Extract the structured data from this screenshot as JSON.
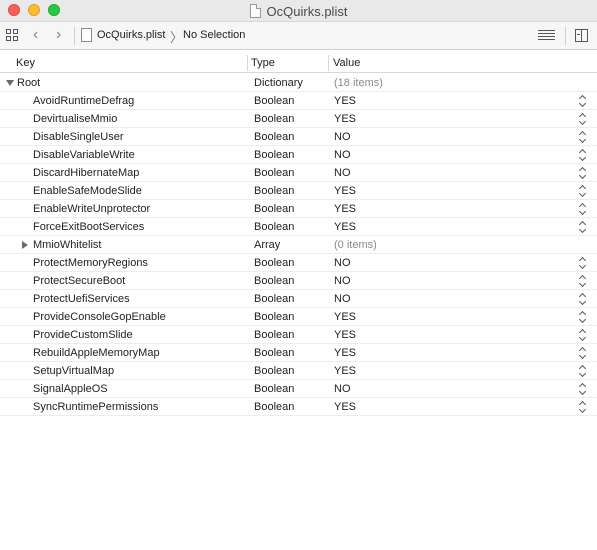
{
  "window": {
    "title": "OcQuirks.plist"
  },
  "jumpbar": {
    "file": "OcQuirks.plist",
    "selection": "No Selection"
  },
  "columns": {
    "key": "Key",
    "type": "Type",
    "value": "Value"
  },
  "root": {
    "key": "Root",
    "type": "Dictionary",
    "value": "(18 items)"
  },
  "rows": [
    {
      "key": "AvoidRuntimeDefrag",
      "type": "Boolean",
      "value": "YES"
    },
    {
      "key": "DevirtualiseMmio",
      "type": "Boolean",
      "value": "YES"
    },
    {
      "key": "DisableSingleUser",
      "type": "Boolean",
      "value": "NO"
    },
    {
      "key": "DisableVariableWrite",
      "type": "Boolean",
      "value": "NO"
    },
    {
      "key": "DiscardHibernateMap",
      "type": "Boolean",
      "value": "NO"
    },
    {
      "key": "EnableSafeModeSlide",
      "type": "Boolean",
      "value": "YES"
    },
    {
      "key": "EnableWriteUnprotector",
      "type": "Boolean",
      "value": "YES"
    },
    {
      "key": "ForceExitBootServices",
      "type": "Boolean",
      "value": "YES"
    },
    {
      "key": "MmioWhitelist",
      "type": "Array",
      "value": "(0 items)"
    },
    {
      "key": "ProtectMemoryRegions",
      "type": "Boolean",
      "value": "NO"
    },
    {
      "key": "ProtectSecureBoot",
      "type": "Boolean",
      "value": "NO"
    },
    {
      "key": "ProtectUefiServices",
      "type": "Boolean",
      "value": "NO"
    },
    {
      "key": "ProvideConsoleGopEnable",
      "type": "Boolean",
      "value": "YES"
    },
    {
      "key": "ProvideCustomSlide",
      "type": "Boolean",
      "value": "YES"
    },
    {
      "key": "RebuildAppleMemoryMap",
      "type": "Boolean",
      "value": "YES"
    },
    {
      "key": "SetupVirtualMap",
      "type": "Boolean",
      "value": "YES"
    },
    {
      "key": "SignalAppleOS",
      "type": "Boolean",
      "value": "NO"
    },
    {
      "key": "SyncRuntimePermissions",
      "type": "Boolean",
      "value": "YES"
    }
  ]
}
